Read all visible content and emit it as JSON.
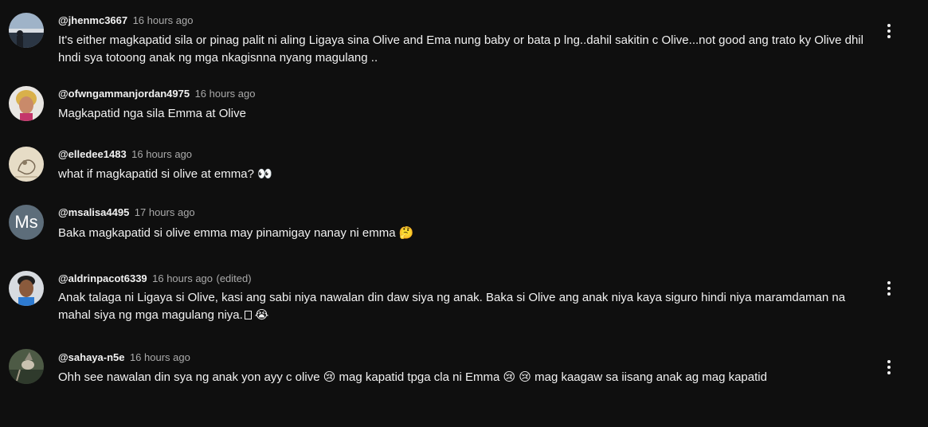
{
  "comments": [
    {
      "author": "@jhenmc3667",
      "time": "16 hours ago",
      "text": "It's either magkapatid sila or pinag palit ni aling Ligaya sina Olive and Ema nung baby or bata p lng..dahil sakitin c Olive...not good ang trato ky Olive dhil hndi sya totoong anak ng mga nkagisnna nyang magulang ..",
      "avatar_icon": "landscape-photo-avatar"
    },
    {
      "author": "@ofwngammanjordan4975",
      "time": "16 hours ago",
      "text": "Magkapatid nga sila Emma at Olive",
      "avatar_icon": "woman-portrait-avatar"
    },
    {
      "author": "@elledee1483",
      "time": "16 hours ago",
      "text": "what if magkapatid si olive at emma?",
      "emoji": "👀",
      "avatar_icon": "sketch-avatar"
    },
    {
      "author": "@msalisa4495",
      "time": "17 hours ago",
      "text": "Baka magkapatid si olive emma may pinamigay nanay ni emma",
      "emoji": "🤔",
      "avatar_letters": "Ms",
      "avatar_color": "#5d6d7a"
    },
    {
      "author": "@aldrinpacot6339",
      "time": "16 hours ago",
      "edited": "(edited)",
      "text_line1": "Anak talaga ni Ligaya si Olive, kasi ang sabi niya nawalan din daw siya ng anak. Baka si Olive ang anak niya kaya siguro hindi niya maramdaman na",
      "text_line2": "mahal siya ng mga magulang niya.",
      "emoji": "😭",
      "avatar_icon": "man-portrait-avatar"
    },
    {
      "author": "@sahaya-n5e",
      "time": "16 hours ago",
      "text_part1": "Ohh see nawalan din sya ng anak yon ayy c olive",
      "text_part2": "mag kapatid tpga cla ni Emma",
      "text_part3": "mag kaagaw sa iisang anak ag mag kapatid",
      "emoji": "😢",
      "avatar_icon": "bird-photo-avatar"
    }
  ],
  "menu_label": "Action menu"
}
